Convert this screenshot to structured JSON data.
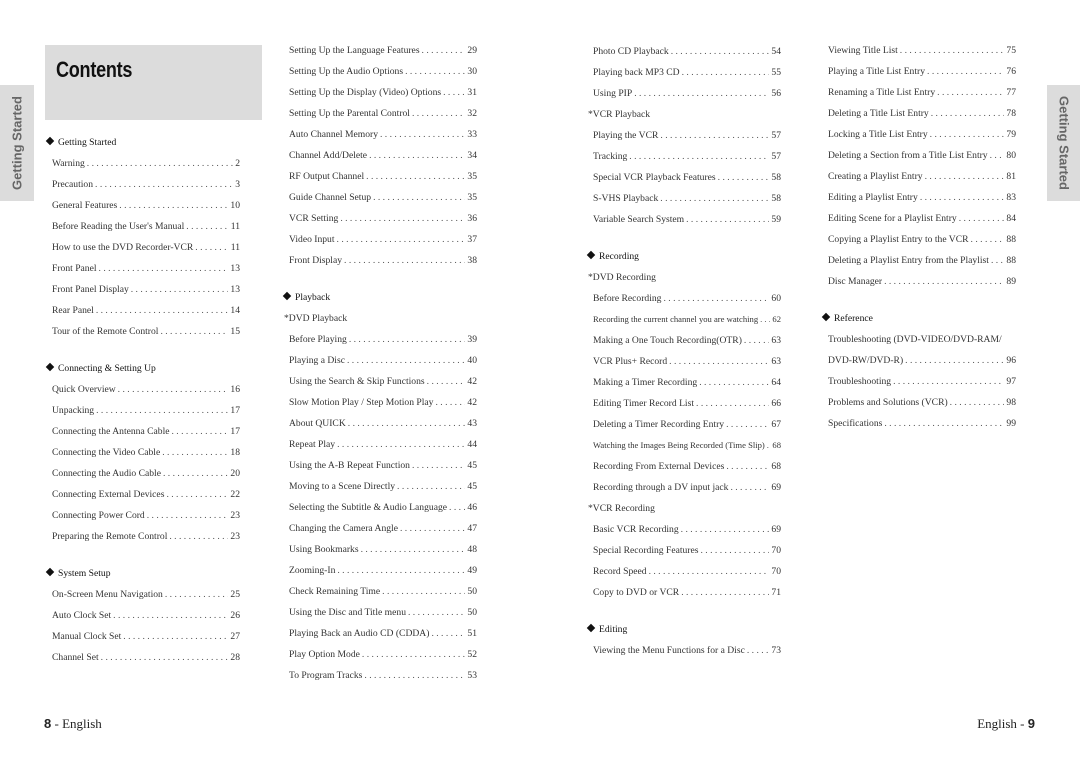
{
  "title": "Contents",
  "side_tab": "Getting Started",
  "footer_left": {
    "page": "8",
    "text": " - English"
  },
  "footer_right": {
    "text": "English - ",
    "page": "9"
  },
  "columns": [
    [
      {
        "type": "header",
        "title": "Getting Started"
      },
      {
        "title": "Warning",
        "page": "2"
      },
      {
        "title": "Precaution",
        "page": "3"
      },
      {
        "title": "General Features",
        "page": "10"
      },
      {
        "title": "Before Reading the User's Manual",
        "page": "11"
      },
      {
        "title": "How to use the DVD Recorder-VCR",
        "page": "11"
      },
      {
        "title": "Front Panel",
        "page": "13"
      },
      {
        "title": "Front Panel Display",
        "page": "13"
      },
      {
        "title": "Rear Panel",
        "page": "14"
      },
      {
        "title": "Tour of the Remote Control",
        "page": "15"
      },
      {
        "type": "header",
        "title": "Connecting & Setting Up"
      },
      {
        "title": "Quick Overview",
        "page": "16"
      },
      {
        "title": "Unpacking",
        "page": "17"
      },
      {
        "title": "Connecting the Antenna Cable",
        "page": "17"
      },
      {
        "title": "Connecting the Video Cable",
        "page": "18"
      },
      {
        "title": "Connecting the Audio Cable",
        "page": "20"
      },
      {
        "title": "Connecting External Devices",
        "page": "22"
      },
      {
        "title": "Connecting Power Cord",
        "page": "23"
      },
      {
        "title": "Preparing the Remote Control",
        "page": "23"
      },
      {
        "type": "header",
        "title": "System Setup"
      },
      {
        "title": "On-Screen Menu Navigation",
        "page": "25"
      },
      {
        "title": "Auto Clock Set",
        "page": "26"
      },
      {
        "title": "Manual Clock Set",
        "page": "27"
      },
      {
        "title": "Channel Set",
        "page": "28"
      }
    ],
    [
      {
        "title": "Setting Up the Language Features",
        "page": "29"
      },
      {
        "title": "Setting Up the Audio Options",
        "page": "30"
      },
      {
        "title": "Setting Up the Display (Video) Options",
        "page": "31"
      },
      {
        "title": "Setting Up the Parental Control",
        "page": "32"
      },
      {
        "title": "Auto Channel Memory",
        "page": "33"
      },
      {
        "title": "Channel Add/Delete",
        "page": "34"
      },
      {
        "title": "RF Output Channel",
        "page": "35"
      },
      {
        "title": "Guide Channel Setup",
        "page": "35"
      },
      {
        "title": "VCR Setting",
        "page": "36"
      },
      {
        "title": "Video Input",
        "page": "37"
      },
      {
        "title": "Front Display",
        "page": "38"
      },
      {
        "type": "header",
        "title": "Playback"
      },
      {
        "type": "sub",
        "title": "*DVD Playback"
      },
      {
        "title": "Before Playing",
        "page": "39"
      },
      {
        "title": "Playing a Disc",
        "page": "40"
      },
      {
        "title": "Using the Search & Skip Functions",
        "page": "42"
      },
      {
        "title": "Slow Motion Play / Step Motion Play",
        "page": "42"
      },
      {
        "title": "About QUICK",
        "page": "43"
      },
      {
        "title": "Repeat Play",
        "page": "44"
      },
      {
        "title": "Using the A-B Repeat Function",
        "page": "45"
      },
      {
        "title": "Moving to a Scene Directly",
        "page": "45"
      },
      {
        "title": "Selecting the Subtitle & Audio Language",
        "page": "46"
      },
      {
        "title": "Changing the Camera Angle",
        "page": "47"
      },
      {
        "title": "Using Bookmarks",
        "page": "48"
      },
      {
        "title": "Zooming-In",
        "page": "49"
      },
      {
        "title": "Check Remaining Time",
        "page": "50"
      },
      {
        "title": "Using the Disc and Title menu",
        "page": "50"
      },
      {
        "title": "Playing Back an Audio CD (CDDA)",
        "page": "51"
      },
      {
        "title": "Play Option Mode",
        "page": "52"
      },
      {
        "title": "To Program Tracks",
        "page": "53"
      }
    ],
    [
      {
        "title": "Photo CD Playback",
        "page": "54"
      },
      {
        "title": "Playing back MP3 CD",
        "page": "55"
      },
      {
        "title": "Using PIP",
        "page": "56"
      },
      {
        "type": "sub",
        "title": "*VCR Playback"
      },
      {
        "title": "Playing the VCR",
        "page": "57"
      },
      {
        "title": "Tracking",
        "page": "57"
      },
      {
        "title": "Special VCR Playback Features",
        "page": "58"
      },
      {
        "title": "S-VHS Playback",
        "page": "58"
      },
      {
        "title": "Variable Search System",
        "page": "59"
      },
      {
        "type": "header",
        "title": "Recording"
      },
      {
        "type": "sub",
        "title": "*DVD Recording"
      },
      {
        "title": "Before Recording",
        "page": "60"
      },
      {
        "title": "Recording the current channel you are watching",
        "page": "62",
        "small": true
      },
      {
        "title": "Making a One Touch Recording(OTR)",
        "page": "63"
      },
      {
        "title": "VCR Plus+ Record",
        "page": "63"
      },
      {
        "title": "Making a Timer Recording",
        "page": "64"
      },
      {
        "title": "Editing Timer Record List",
        "page": "66"
      },
      {
        "title": "Deleting a Timer Recording Entry",
        "page": "67"
      },
      {
        "title": "Watching the Images Being Recorded (Time Slip)",
        "page": "68",
        "small": true
      },
      {
        "title": "Recording From External Devices",
        "page": "68"
      },
      {
        "title": "Recording through a DV input jack",
        "page": "69"
      },
      {
        "type": "sub",
        "title": "*VCR Recording"
      },
      {
        "title": "Basic VCR Recording",
        "page": "69"
      },
      {
        "title": "Special Recording Features",
        "page": "70"
      },
      {
        "title": "Record Speed",
        "page": "70"
      },
      {
        "title": "Copy to DVD or VCR",
        "page": "71"
      },
      {
        "type": "header",
        "title": "Editing"
      },
      {
        "title": "Viewing the Menu Functions for a Disc",
        "page": "73"
      }
    ],
    [
      {
        "title": "Viewing Title List",
        "page": "75"
      },
      {
        "title": "Playing a Title List Entry",
        "page": "76"
      },
      {
        "title": "Renaming a Title List Entry",
        "page": "77"
      },
      {
        "title": "Deleting a Title List Entry",
        "page": "78"
      },
      {
        "title": "Locking a Title List Entry",
        "page": "79"
      },
      {
        "title": "Deleting a Section from a Title List Entry",
        "page": "80"
      },
      {
        "title": "Creating a Playlist Entry",
        "page": "81"
      },
      {
        "title": "Editing a Playlist Entry",
        "page": "83"
      },
      {
        "title": "Editing Scene for a Playlist Entry",
        "page": "84"
      },
      {
        "title": "Copying a Playlist Entry to the VCR",
        "page": "88"
      },
      {
        "title": "Deleting a Playlist Entry from the Playlist",
        "page": "88"
      },
      {
        "title": "Disc Manager",
        "page": "89"
      },
      {
        "type": "header",
        "title": "Reference"
      },
      {
        "type": "line",
        "title": "Troubleshooting (DVD-VIDEO/DVD-RAM/"
      },
      {
        "title": "DVD-RW/DVD-R)",
        "page": "96"
      },
      {
        "title": "Troubleshooting",
        "page": "97"
      },
      {
        "title": "Problems and Solutions (VCR)",
        "page": "98"
      },
      {
        "title": "Specifications",
        "page": "99"
      }
    ]
  ]
}
